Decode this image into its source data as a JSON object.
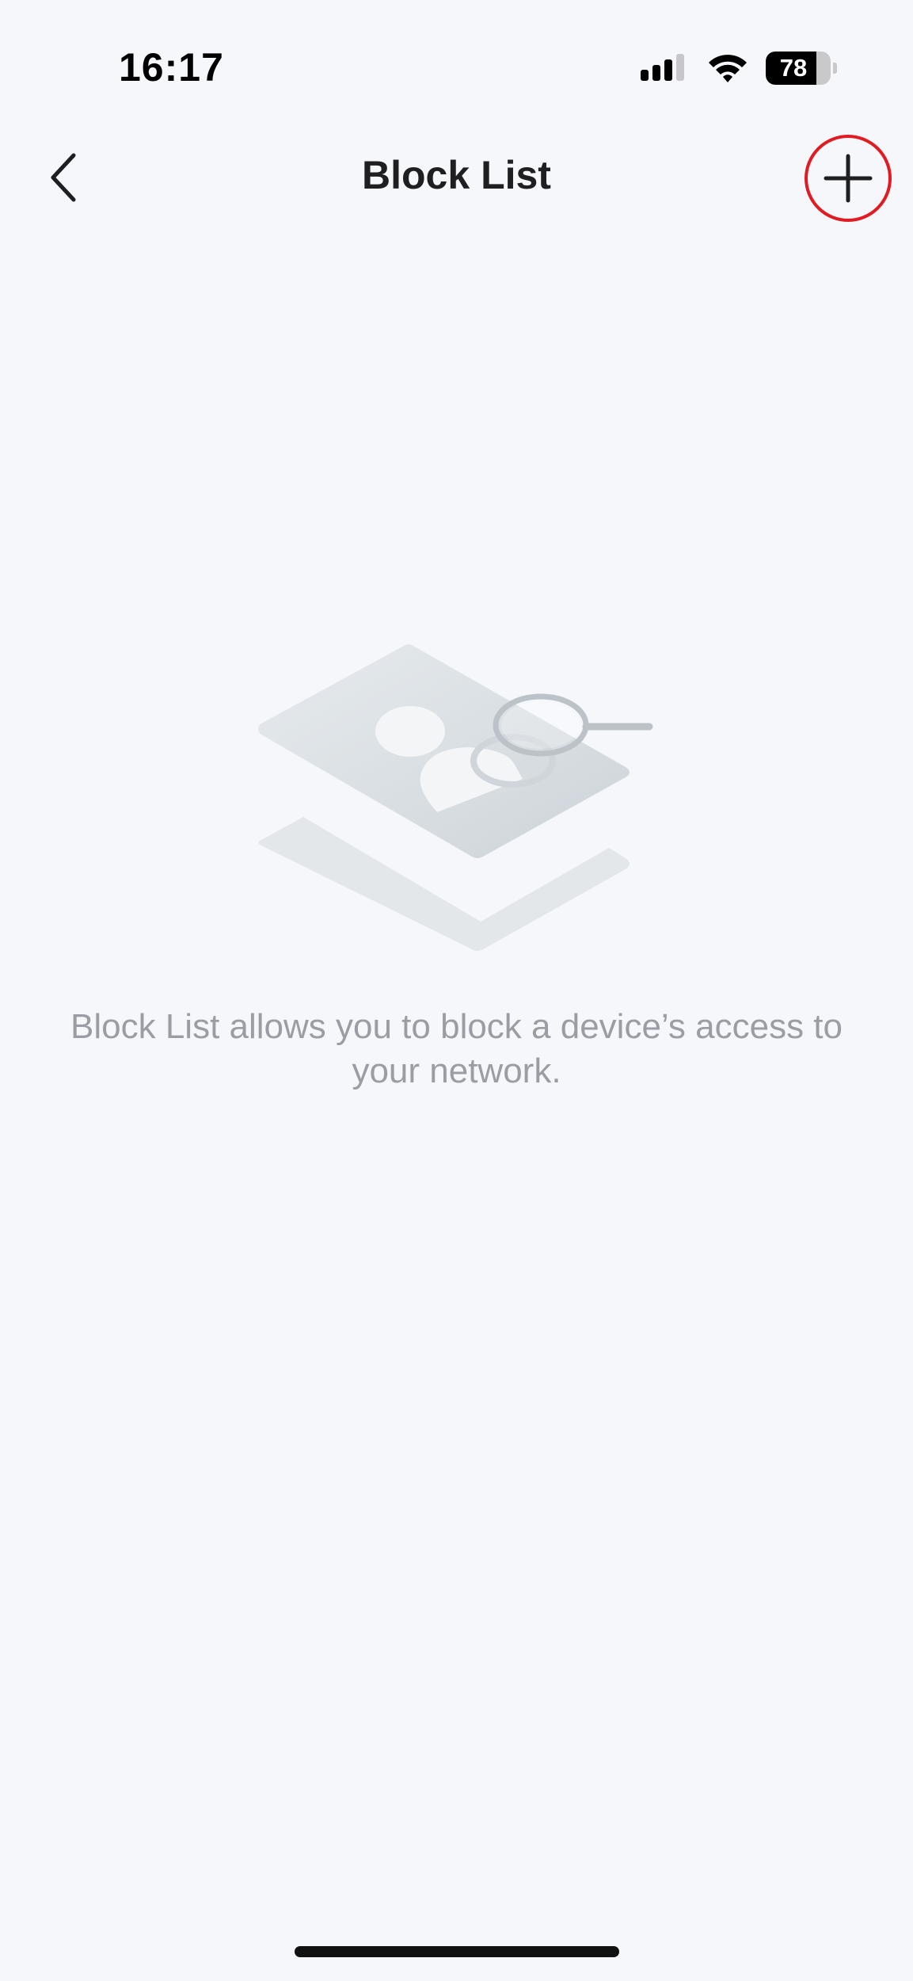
{
  "status_bar": {
    "time": "16:17",
    "battery_level": "78",
    "battery_fraction": 0.78,
    "icons": [
      "cellular-signal-icon",
      "wifi-icon",
      "battery-icon"
    ]
  },
  "nav": {
    "title": "Block List",
    "back_icon": "chevron-left-icon",
    "add_icon": "plus-icon",
    "highlight_color": "#e11b22"
  },
  "empty_state": {
    "illustration": "profile-card-magnifier-illustration",
    "message": "Block List allows you to block a device’s access to your network."
  },
  "colors": {
    "background": "#f5f7fb",
    "title": "#1f1f22",
    "message": "#9a9da3"
  }
}
